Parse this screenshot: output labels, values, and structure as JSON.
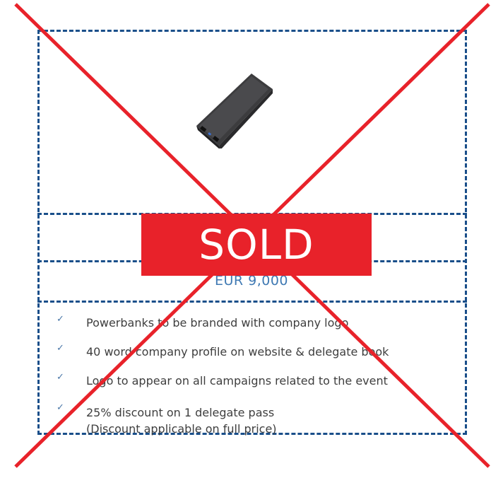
{
  "badge": {
    "sold_label": "SOLD"
  },
  "price": "EUR 9,000",
  "product": {
    "image": "powerbank"
  },
  "features": [
    {
      "lines": [
        "Powerbanks to be branded with company logo"
      ]
    },
    {
      "lines": [
        "40 word company profile on website & delegate book"
      ]
    },
    {
      "lines": [
        "Logo to appear on all campaigns related to the event"
      ]
    },
    {
      "lines": [
        "25% discount on 1 delegate pass",
        "(Discount applicable on full price)"
      ]
    }
  ],
  "colors": {
    "border": "#1a4f8a",
    "price": "#3f79b3",
    "sold": "#e8222a",
    "cross": "#e8222a"
  }
}
